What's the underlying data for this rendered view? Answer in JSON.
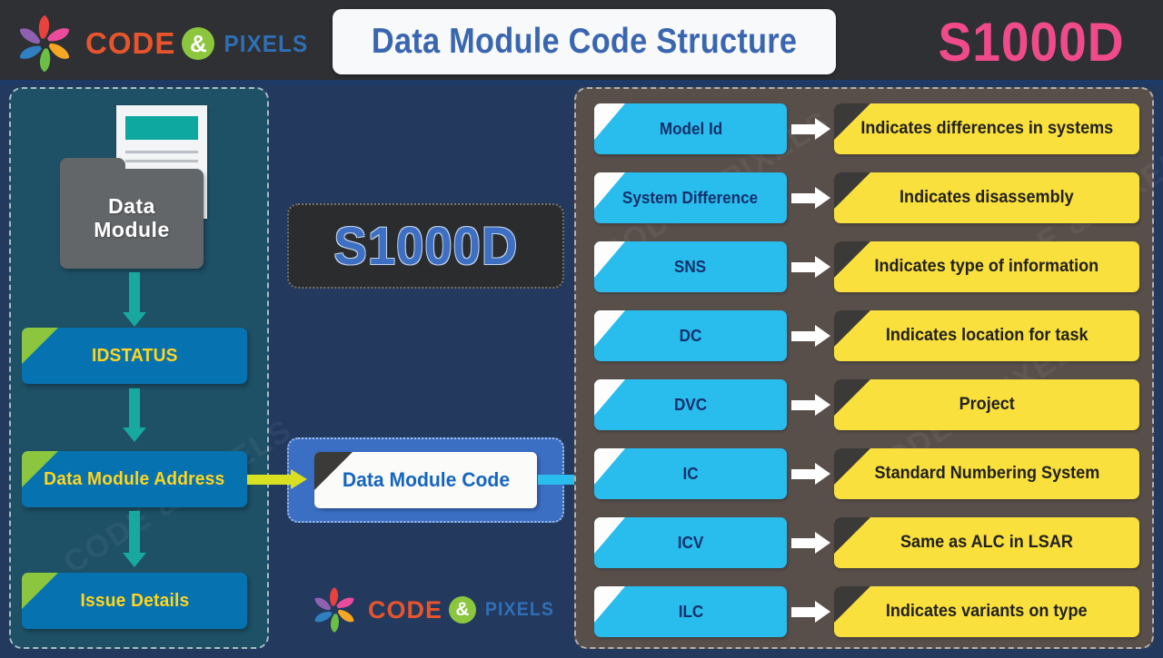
{
  "header": {
    "logo": {
      "code": "CODE",
      "amp": "&",
      "pixels": "PIXELS",
      "mark_icon": "pinwheel-logo-icon"
    },
    "title": "Data Module Code Structure",
    "brand": "S1000D",
    "brand_color": "#ef4b8b",
    "title_color": "#3a66b0",
    "bar_color": "#2e3033"
  },
  "left_panel": {
    "doc_icon_name": "document-icon",
    "folder_icon_name": "folder-icon",
    "folder_label_line1": "Data",
    "folder_label_line2": "Module",
    "boxes": [
      {
        "label": "IDSTATUS"
      },
      {
        "label": "Data Module Address"
      },
      {
        "label": "Issue Details"
      }
    ],
    "box_color": "#0672b0",
    "corner_color": "#8cc63f",
    "label_color": "#ffd51e",
    "arrow_color": "#17a9a0",
    "bg_color": "#1e5066"
  },
  "middle_panel": {
    "standard_badge": "S1000D",
    "code_box_label": "Data Module Code",
    "badge_bg": "#2a2c2e",
    "badge_text_color": "#3d6fc2",
    "code_outer_bg": "#3b6fc4",
    "code_text_color": "#1565c0",
    "in_arrow_color": "#d9e021",
    "out_arrow_color": "#29bdee"
  },
  "right_panel": {
    "bg_color": "#584f4b",
    "code_color": "#29bdee",
    "desc_color": "#f9e03d",
    "arrow_color": "#ffffff",
    "rows": [
      {
        "code": "Model Id",
        "description": "Indicates differences in systems"
      },
      {
        "code": "System Difference",
        "description": "Indicates disassembly"
      },
      {
        "code": "SNS",
        "description": "Indicates type of information"
      },
      {
        "code": "DC",
        "description": "Indicates location for task"
      },
      {
        "code": "DVC",
        "description": "Project"
      },
      {
        "code": "IC",
        "description": "Standard Numbering System"
      },
      {
        "code": "ICV",
        "description": "Same as ALC in LSAR"
      },
      {
        "code": "ILC",
        "description": "Indicates variants on type"
      }
    ]
  },
  "footer": {
    "logo": {
      "code": "CODE",
      "amp": "&",
      "pixels": "PIXELS",
      "mark_icon": "pinwheel-logo-icon"
    }
  },
  "watermarks": {
    "text": "CODE & PIXELS"
  },
  "page_bg": "#23395e"
}
